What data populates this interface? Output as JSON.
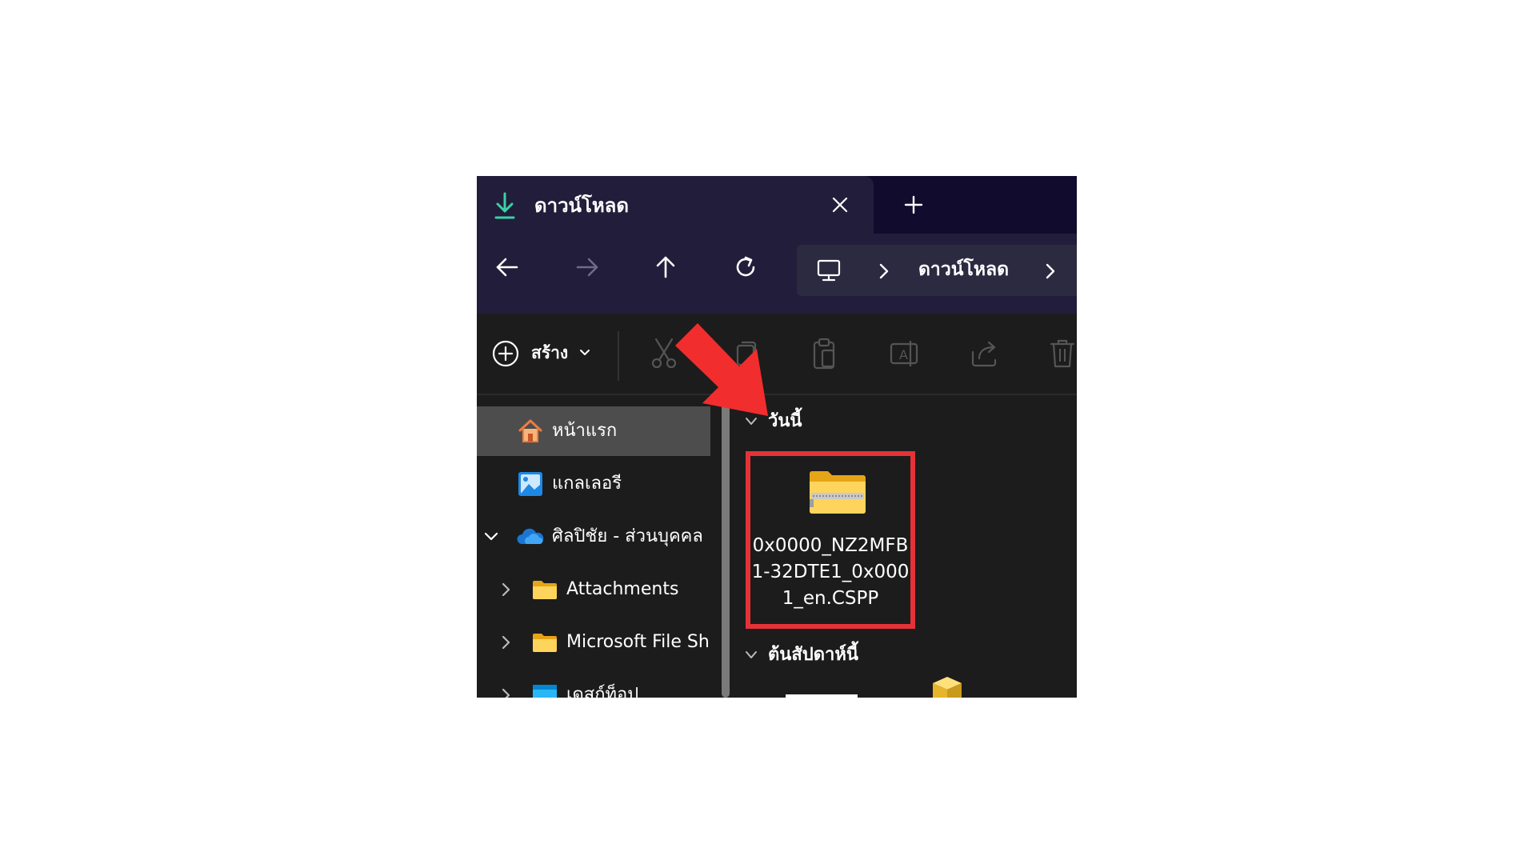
{
  "window": {
    "tab": {
      "icon": "download-icon",
      "title": "ดาวน์โหลด",
      "close_icon": "close-icon",
      "new_tab_icon": "plus-icon"
    },
    "nav": {
      "back_icon": "arrow-left-icon",
      "forward_icon": "arrow-right-icon",
      "up_icon": "arrow-up-icon",
      "refresh_icon": "refresh-icon",
      "address": {
        "root_icon": "monitor-icon",
        "segments": [
          "ดาวน์โหลด"
        ]
      }
    },
    "command_bar": {
      "new_label": "สร้าง",
      "new_icon": "plus-circle-icon",
      "actions": [
        "cut-icon",
        "copy-icon",
        "paste-icon",
        "rename-icon",
        "share-icon",
        "delete-icon"
      ]
    },
    "sidebar": {
      "items": [
        {
          "label": "หน้าแรก",
          "icon": "home-icon",
          "selected": true
        },
        {
          "label": "แกลเลอรี",
          "icon": "gallery-icon"
        },
        {
          "label": "ศิลปิชัย - ส่วนบุคคล",
          "icon": "onedrive-cloud-icon",
          "expanded": true
        },
        {
          "label": "Attachments",
          "icon": "folder-icon"
        },
        {
          "label": "Microsoft File Sh",
          "icon": "folder-icon"
        },
        {
          "label": "เดสก์ท็อป",
          "icon": "desktop-folder-icon"
        }
      ]
    },
    "content": {
      "groups": [
        {
          "label": "วันนี้"
        },
        {
          "label": "ต้นสัปดาห์นี้"
        }
      ],
      "files": [
        {
          "name": "0x0000_NZ2MFB1-32DTE1_0x0001_en.CSPP",
          "icon": "zip-folder-icon",
          "highlighted": true
        }
      ]
    },
    "annotation": {
      "arrow_color": "#f22d2d",
      "highlight_color": "#e53238"
    }
  },
  "colors": {
    "titlebar": "#110b2e",
    "tab": "#221d3a",
    "body": "#1c1c1c",
    "selected_item": "#4d4d4d"
  }
}
